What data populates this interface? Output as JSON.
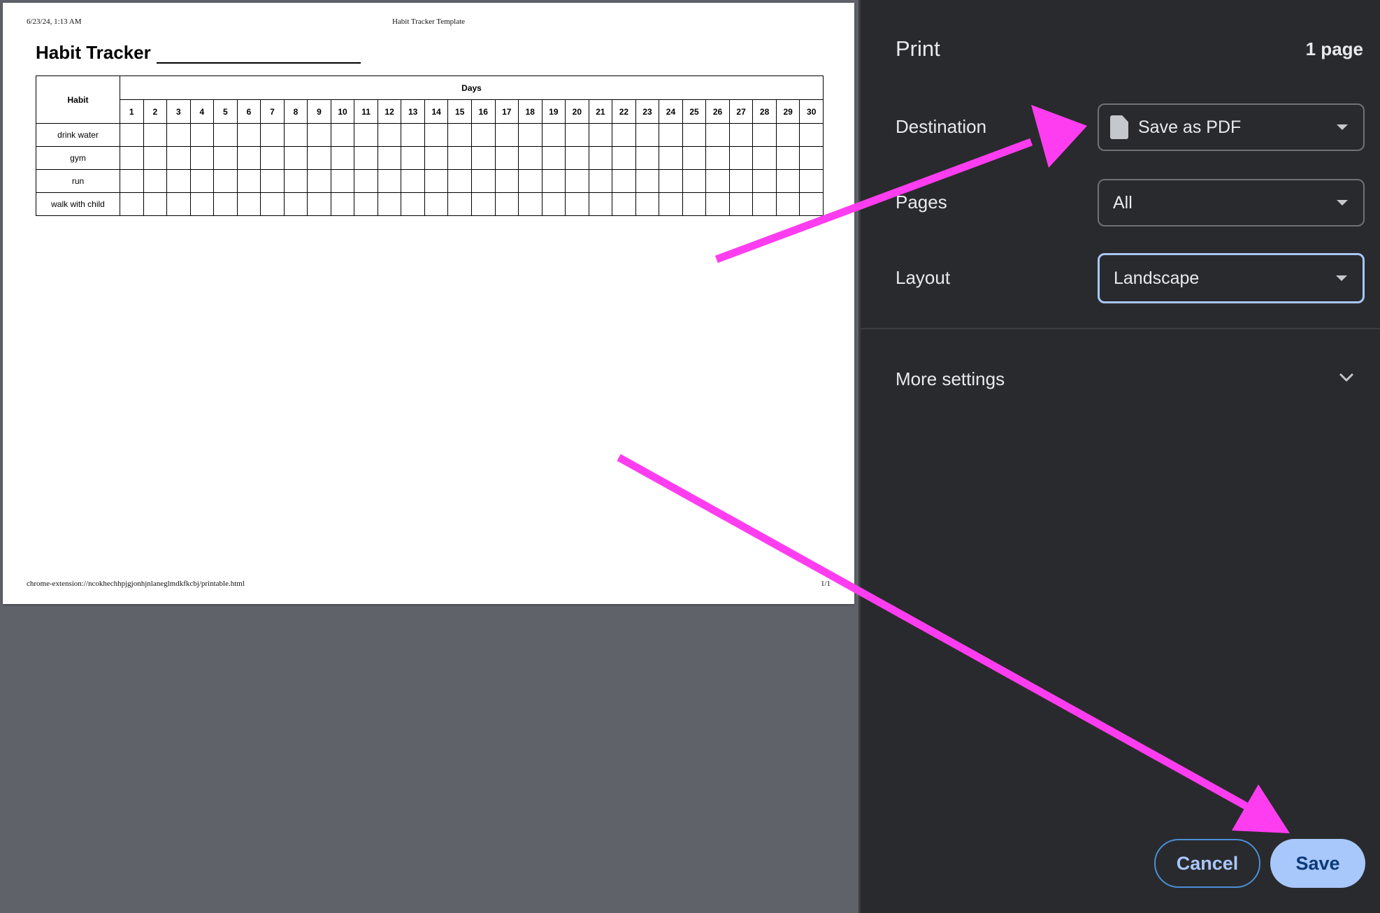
{
  "preview": {
    "print_date": "6/23/24, 1:13 AM",
    "print_doc_title": "Habit Tracker Template",
    "doc_title": "Habit Tracker",
    "table": {
      "habit_header": "Habit",
      "days_header": "Days",
      "days": [
        "1",
        "2",
        "3",
        "4",
        "5",
        "6",
        "7",
        "8",
        "9",
        "10",
        "11",
        "12",
        "13",
        "14",
        "15",
        "16",
        "17",
        "18",
        "19",
        "20",
        "21",
        "22",
        "23",
        "24",
        "25",
        "26",
        "27",
        "28",
        "29",
        "30"
      ],
      "habits": [
        "drink water",
        "gym",
        "run",
        "walk with child"
      ]
    },
    "footer_url": "chrome-extension://ncokhechhpjgjonhjnlaneglmdkfkcbj/printable.html",
    "footer_page": "1/1"
  },
  "sidebar": {
    "title": "Print",
    "page_count": "1 page",
    "destination": {
      "label": "Destination",
      "value": "Save as PDF",
      "icon": "file-icon"
    },
    "pages": {
      "label": "Pages",
      "value": "All"
    },
    "layout": {
      "label": "Layout",
      "value": "Landscape"
    },
    "more_settings": {
      "label": "More settings",
      "icon": "chevron-down-icon"
    },
    "buttons": {
      "cancel": "Cancel",
      "save": "Save"
    }
  },
  "colors": {
    "sidebar_bg": "#292a2d",
    "preview_bg": "#5f6268",
    "accent": "#a8c7fa",
    "annotation_arrow": "#ff3df0"
  }
}
